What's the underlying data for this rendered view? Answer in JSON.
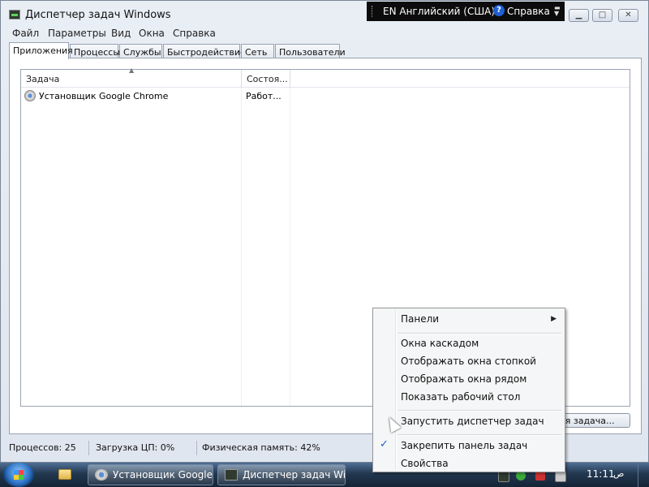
{
  "window": {
    "title": "Диспетчер задач Windows",
    "menu": [
      "Файл",
      "Параметры",
      "Вид",
      "Окна",
      "Справка"
    ]
  },
  "langbar": {
    "language": "EN Английский (США)",
    "help_label": "Справка",
    "help_icon": "help-icon",
    "help_glyph": "?"
  },
  "tabs": [
    "Приложения",
    "Процессы",
    "Службы",
    "Быстродействие",
    "Сеть",
    "Пользователи"
  ],
  "active_tab": "Приложения",
  "tasks": {
    "columns": [
      "Задача",
      "Состоя..."
    ],
    "rows": [
      {
        "name": "Установщик Google Chrome",
        "status": "Работ..."
      }
    ]
  },
  "new_task_button": "ая задача...",
  "status_bar": {
    "processes": "Процессов: 25",
    "cpu": "Загрузка ЦП: 0%",
    "memory": "Физическая память: 42%"
  },
  "taskbar": {
    "buttons": [
      {
        "label": "Установщик Google...",
        "icon": "chrome-installer-icon"
      },
      {
        "label": "Диспетчер задач Wi...",
        "icon": "task-manager-icon"
      }
    ],
    "clock": "11:11",
    "clock_suffix": "ص"
  },
  "context_menu": {
    "toolbars": "Панели",
    "cascade": "Окна каскадом",
    "stacked": "Отображать окна стопкой",
    "side_by_side": "Отображать окна рядом",
    "show_desktop": "Показать рабочий стол",
    "start_task_manager": "Запустить диспетчер задач",
    "lock_taskbar": "Закрепить панель задач",
    "properties": "Свойства",
    "submenu_arrow": "▶",
    "check_mark": "✓"
  },
  "colors": {
    "taskbar": "#22384f",
    "accent": "#1a5fc4",
    "menu_bg": "#f5f6f7"
  }
}
